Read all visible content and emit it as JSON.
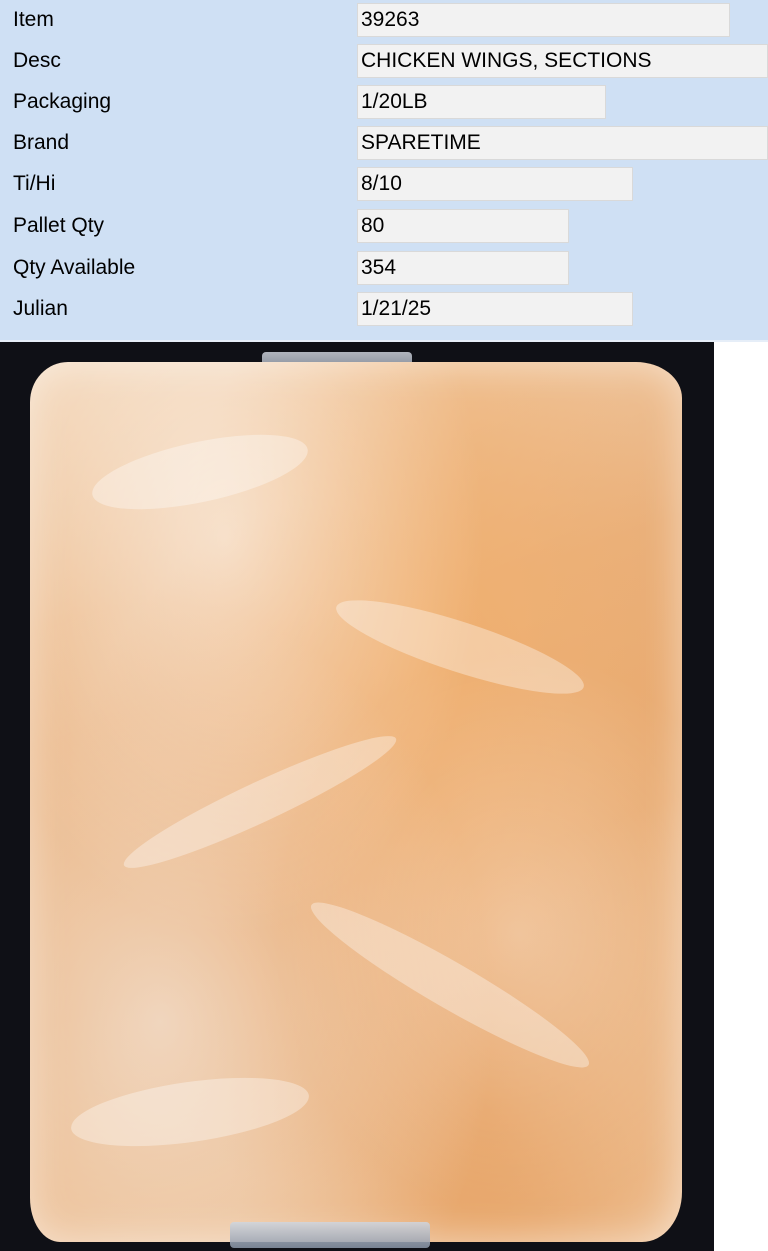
{
  "spec": {
    "item_label": "Item",
    "item_value": "39263",
    "desc_label": "Desc",
    "desc_value": "CHICKEN WINGS, SECTIONS",
    "packaging_label": "Packaging",
    "packaging_value": "1/20LB",
    "brand_label": "Brand",
    "brand_value": "SPARETIME",
    "tihi_label": "Ti/Hi",
    "tihi_value": "8/10",
    "pallet_label": "Pallet Qty",
    "pallet_value": "80",
    "qty_available_label": "Qty Available",
    "qty_available_value": "354",
    "julian_label": "Julian",
    "julian_value": " 1/21/25"
  },
  "colors": {
    "panel_background": "#cfe0f4",
    "field_background": "#f2f2f2",
    "photo_background": "#0f1016"
  }
}
